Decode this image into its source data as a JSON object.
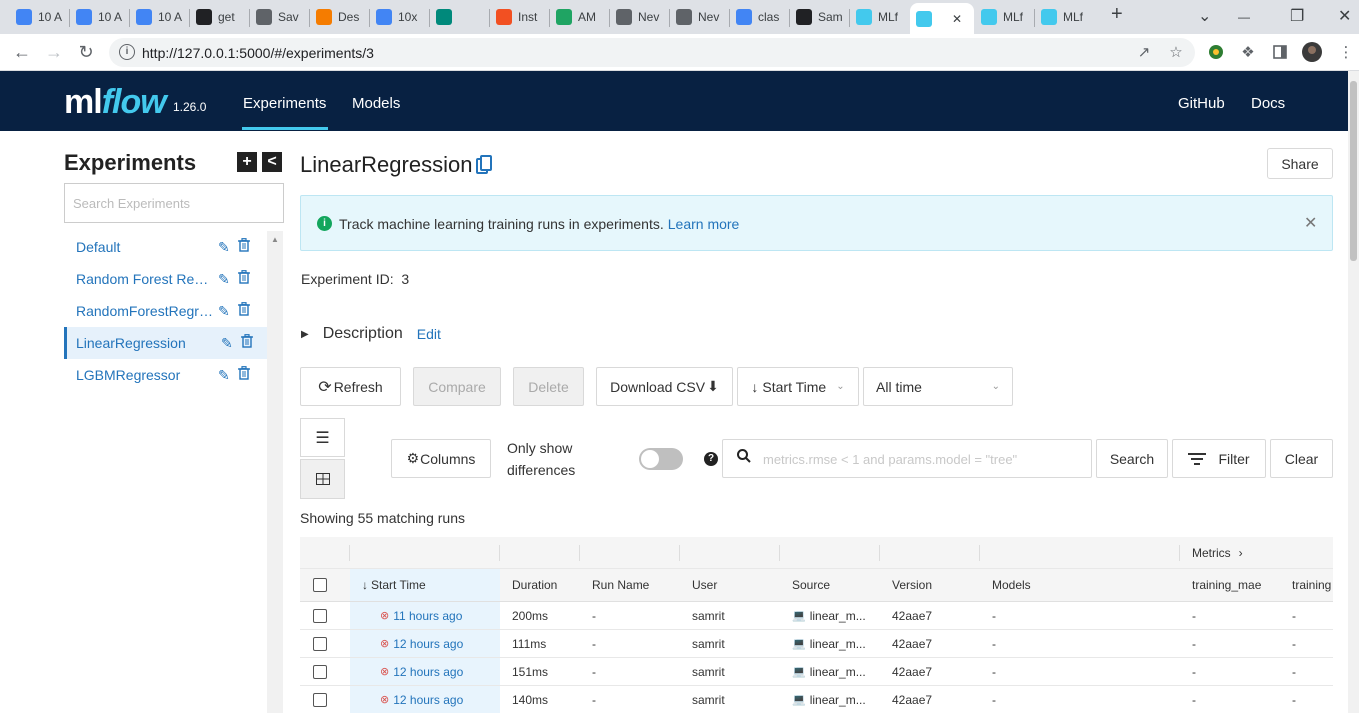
{
  "browser": {
    "tabs": [
      {
        "label": "10 A",
        "icon": "docs-icon",
        "color": "#4285f4"
      },
      {
        "label": "10 A",
        "icon": "docs-icon",
        "color": "#4285f4"
      },
      {
        "label": "10 A",
        "icon": "docs-icon",
        "color": "#4285f4"
      },
      {
        "label": "get",
        "icon": "github-icon",
        "color": "#202124"
      },
      {
        "label": "Sav",
        "icon": "image-icon",
        "color": "#5f6368"
      },
      {
        "label": "Des",
        "icon": "loader-icon",
        "color": "#f57c00"
      },
      {
        "label": "10x",
        "icon": "docs-icon",
        "color": "#4285f4"
      },
      {
        "label": "",
        "icon": "meet-icon",
        "color": "#00897b"
      },
      {
        "label": "Inst",
        "icon": "microsoft-icon",
        "color": "#f25022"
      },
      {
        "label": "AM",
        "icon": "drive-icon",
        "color": "#1fa463"
      },
      {
        "label": "Nev",
        "icon": "chrome-icon",
        "color": "#5f6368"
      },
      {
        "label": "Nev",
        "icon": "chrome-icon",
        "color": "#5f6368"
      },
      {
        "label": "clas",
        "icon": "google-icon",
        "color": "#4285f4"
      },
      {
        "label": "Sam",
        "icon": "github-icon",
        "color": "#202124"
      },
      {
        "label": "MLf",
        "icon": "mlflow-icon",
        "color": "#43c9ed"
      },
      {
        "label": "",
        "icon": "mlflow-icon",
        "color": "#43c9ed"
      },
      {
        "label": "MLf",
        "icon": "mlflow-icon",
        "color": "#43c9ed"
      },
      {
        "label": "MLf",
        "icon": "mlflow-icon",
        "color": "#43c9ed"
      }
    ],
    "url": "http://127.0.0.1:5000/#/experiments/3"
  },
  "header": {
    "logo_ml": "ml",
    "logo_flow": "flow",
    "version": "1.26.0",
    "nav": [
      "Experiments",
      "Models"
    ],
    "right_nav": [
      "GitHub",
      "Docs"
    ]
  },
  "sidebar": {
    "title": "Experiments",
    "search_placeholder": "Search Experiments",
    "items": [
      {
        "label": "Default"
      },
      {
        "label": "Random Forest Regressor"
      },
      {
        "label": "RandomForestRegressor"
      },
      {
        "label": "LinearRegression"
      },
      {
        "label": "LGBMRegressor"
      }
    ]
  },
  "main": {
    "title": "LinearRegression",
    "share_label": "Share",
    "alert_text": "Track machine learning training runs in experiments.",
    "alert_link": "Learn more",
    "experiment_id_label": "Experiment ID:",
    "experiment_id": "3",
    "description_label": "Description",
    "edit_label": "Edit",
    "refresh_label": "Refresh",
    "compare_label": "Compare",
    "delete_label": "Delete",
    "download_label": "Download CSV",
    "sort_label": "Start Time",
    "time_label": "All time",
    "columns_label": "Columns",
    "only_show_line1": "Only show",
    "only_show_line2": "differences",
    "search_placeholder": "metrics.rmse < 1 and params.model = \"tree\"",
    "search_label": "Search",
    "filter_label": "Filter",
    "clear_label": "Clear",
    "showing_text": "Showing 55 matching runs"
  },
  "table": {
    "group_label": "Metrics",
    "headers": [
      "Start Time",
      "Duration",
      "Run Name",
      "User",
      "Source",
      "Version",
      "Models",
      "training_mae",
      "training"
    ],
    "rows": [
      {
        "start": "11 hours ago",
        "duration": "200ms",
        "run_name": "-",
        "user": "samrit",
        "source": "linear_m...",
        "version": "42aae7",
        "models": "-",
        "mae": "-",
        "training": "-"
      },
      {
        "start": "12 hours ago",
        "duration": "111ms",
        "run_name": "-",
        "user": "samrit",
        "source": "linear_m...",
        "version": "42aae7",
        "models": "-",
        "mae": "-",
        "training": "-"
      },
      {
        "start": "12 hours ago",
        "duration": "151ms",
        "run_name": "-",
        "user": "samrit",
        "source": "linear_m...",
        "version": "42aae7",
        "models": "-",
        "mae": "-",
        "training": "-"
      },
      {
        "start": "12 hours ago",
        "duration": "140ms",
        "run_name": "-",
        "user": "samrit",
        "source": "linear_m...",
        "version": "42aae7",
        "models": "-",
        "mae": "-",
        "training": "-"
      }
    ]
  },
  "colors": {
    "header_bg": "#082142",
    "accent": "#43c9ed",
    "link": "#2374bb",
    "error": "#d9534f"
  }
}
